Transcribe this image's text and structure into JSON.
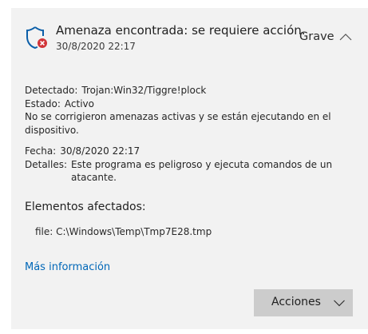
{
  "header": {
    "title": "Amenaza encontrada: se requiere acción.",
    "timestamp": "30/8/2020 22:17",
    "severity": "Grave",
    "icon": "shield-error-icon",
    "collapse_icon": "chevron-up-icon"
  },
  "details": {
    "detected_label": "Detectado:",
    "detected_value": "Trojan:Win32/Tiggre!plock",
    "status_label": "Estado:",
    "status_value": "Activo",
    "status_note": "No se corrigieron amenazas activas y se están ejecutando en el dispositivo.",
    "date_label": "Fecha:",
    "date_value": "30/8/2020 22:17",
    "details_label": "Detalles:",
    "details_value": "Este programa es peligroso y ejecuta comandos de un atacante."
  },
  "affected": {
    "title": "Elementos afectados:",
    "file": "file: C:\\Windows\\Temp\\Tmp7E28.tmp"
  },
  "links": {
    "more_info": "Más información"
  },
  "actions": {
    "label": "Acciones",
    "icon": "chevron-down-icon"
  },
  "colors": {
    "panel_bg": "#f2f2f2",
    "link": "#0067b8",
    "button_bg": "#cccccc",
    "shield": "#0a5ea8",
    "error_badge": "#d13438"
  }
}
